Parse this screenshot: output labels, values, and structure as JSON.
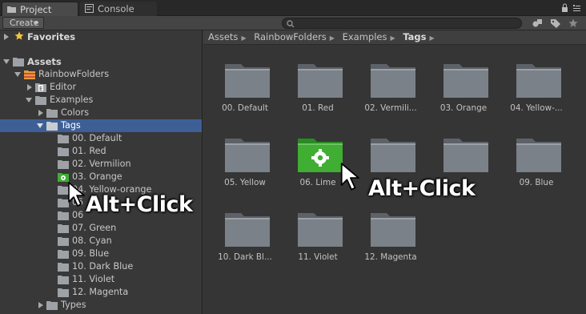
{
  "tabs": [
    {
      "label": "Project",
      "icon": "folder-tab-icon",
      "active": true
    },
    {
      "label": "Console",
      "icon": "console-icon",
      "active": false
    }
  ],
  "toolbar": {
    "create_label": "Create",
    "search_value": ""
  },
  "tree": {
    "favorites_label": "Favorites",
    "assets_label": "Assets",
    "rainbow_label": "RainbowFolders",
    "editor_label": "Editor",
    "examples_label": "Examples",
    "colors_label": "Colors",
    "tags_label": "Tags",
    "tag_items": [
      "00. Default",
      "01. Red",
      "02. Vermilion",
      "03. Orange",
      "04. Yellow-orange",
      "05",
      "06",
      "07. Green",
      "08. Cyan",
      "09. Blue",
      "10. Dark Blue",
      "11. Violet",
      "12. Magenta"
    ],
    "types_label": "Types"
  },
  "breadcrumb": [
    "Assets",
    "RainbowFolders",
    "Examples",
    "Tags"
  ],
  "grid": [
    "00. Default",
    "01. Red",
    "02. Vermili...",
    "03. Orange",
    "04. Yellow-...",
    "05. Yellow",
    "06. Lime",
    "",
    "",
    "09. Blue",
    "10. Dark Bl...",
    "11. Violet",
    "12. Magenta"
  ],
  "callouts": {
    "left": "Alt+Click",
    "right": "Alt+Click"
  },
  "colors": {
    "selection": "#3e5f96",
    "folder_gray": "#7b8188",
    "lime_green": "#3fae32"
  }
}
